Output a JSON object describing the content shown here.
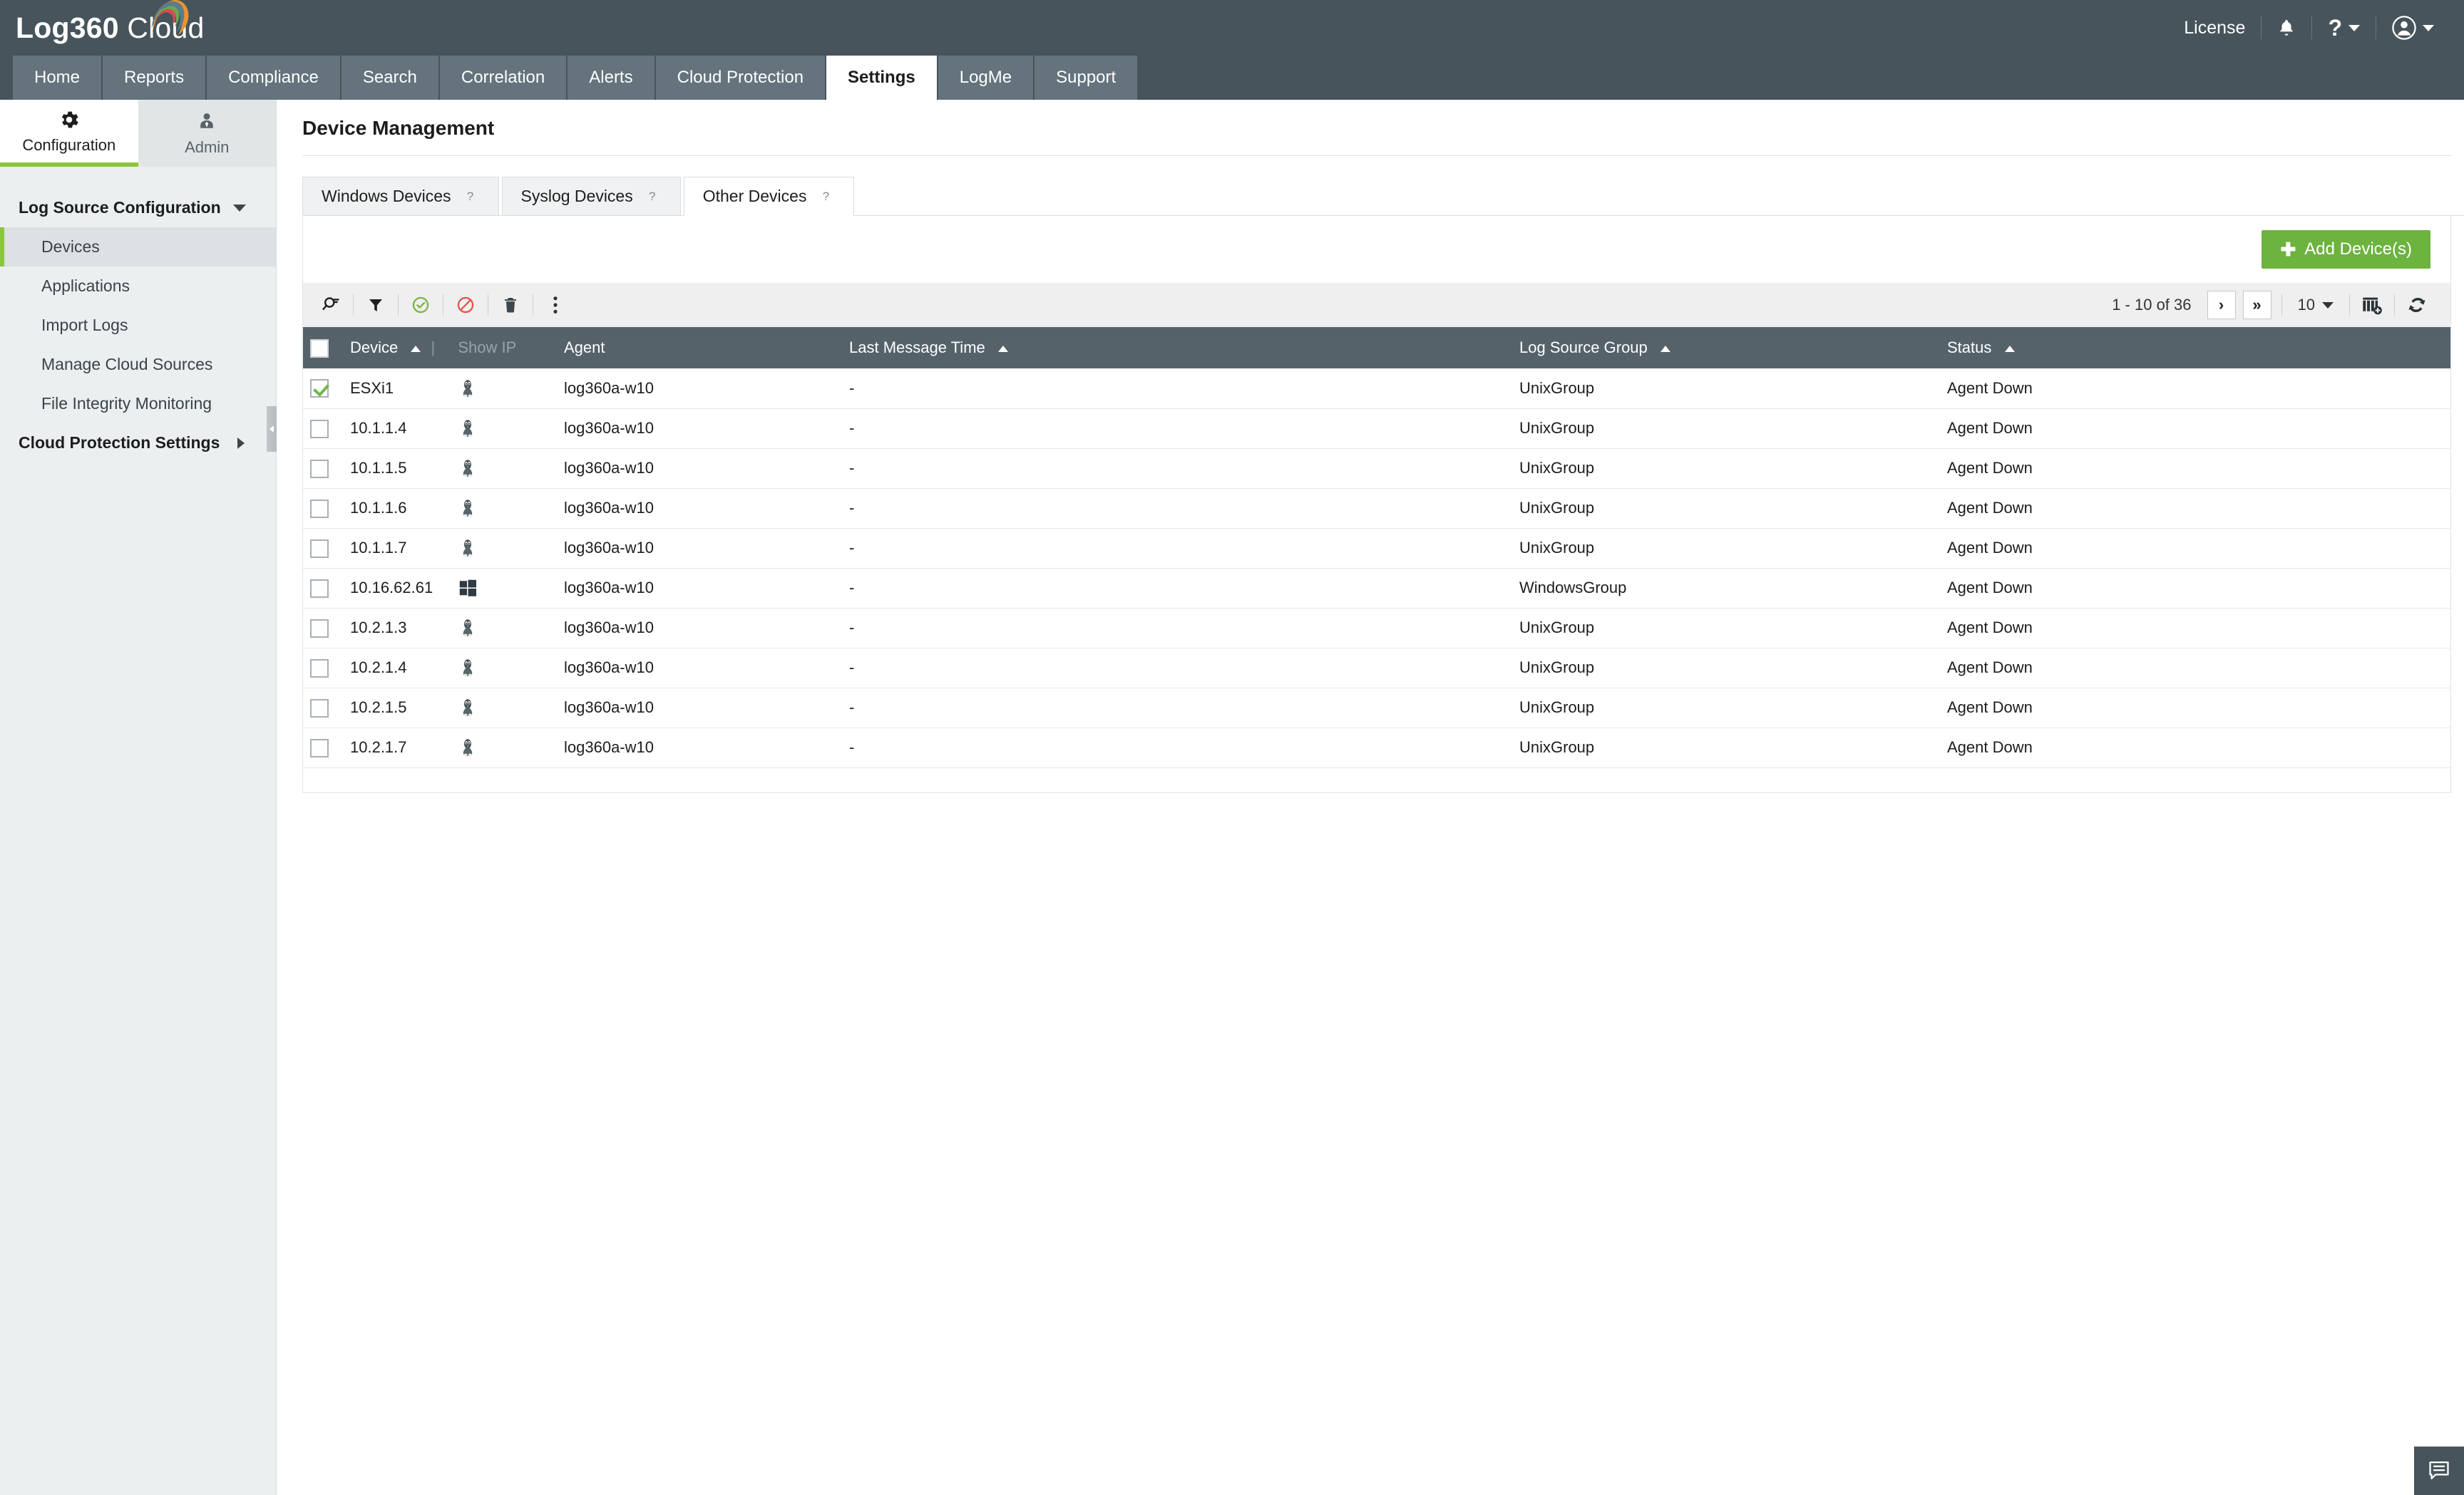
{
  "topbar": {
    "brand_primary": "Log360",
    "brand_secondary": "Cloud",
    "license_label": "License",
    "bell_icon": "bell-icon",
    "help_icon": "question-mark-icon",
    "user_icon": "user-avatar-icon"
  },
  "mainnav": {
    "tabs": [
      {
        "label": "Home",
        "active": false
      },
      {
        "label": "Reports",
        "active": false
      },
      {
        "label": "Compliance",
        "active": false
      },
      {
        "label": "Search",
        "active": false
      },
      {
        "label": "Correlation",
        "active": false
      },
      {
        "label": "Alerts",
        "active": false
      },
      {
        "label": "Cloud Protection",
        "active": false
      },
      {
        "label": "Settings",
        "active": true
      },
      {
        "label": "LogMe",
        "active": false
      },
      {
        "label": "Support",
        "active": false
      }
    ]
  },
  "sidebar": {
    "tabs": [
      {
        "label": "Configuration",
        "icon": "gear-icon",
        "active": true
      },
      {
        "label": "Admin",
        "icon": "user-tie-icon",
        "active": false
      }
    ],
    "sections": [
      {
        "label": "Log Source Configuration",
        "expanded": true,
        "items": [
          {
            "label": "Devices",
            "active": true
          },
          {
            "label": "Applications",
            "active": false
          },
          {
            "label": "Import Logs",
            "active": false
          },
          {
            "label": "Manage Cloud Sources",
            "active": false
          },
          {
            "label": "File Integrity Monitoring",
            "active": false
          }
        ]
      },
      {
        "label": "Cloud Protection Settings",
        "expanded": false,
        "items": []
      }
    ]
  },
  "main": {
    "page_title": "Device Management",
    "tabs": [
      {
        "label": "Windows Devices",
        "help": "?",
        "active": false
      },
      {
        "label": "Syslog Devices",
        "help": "?",
        "active": false
      },
      {
        "label": "Other Devices",
        "help": "?",
        "active": true
      }
    ],
    "add_button": {
      "plus": "✚",
      "label": "Add Device(s)"
    },
    "toolbar": {
      "icons": [
        {
          "name": "search-icon"
        },
        {
          "name": "filter-icon"
        },
        {
          "name": "enable-check-icon"
        },
        {
          "name": "disable-block-icon"
        },
        {
          "name": "delete-trash-icon"
        },
        {
          "name": "more-options-icon"
        }
      ],
      "pagination_label": "1 - 10 of 36",
      "next_page_glyph": "›",
      "last_page_glyph": "»",
      "page_size": "10",
      "column-chooser_icon": "column-settings-icon",
      "refresh_icon": "refresh-icon"
    },
    "table": {
      "columns": [
        {
          "key": "device",
          "label": "Device",
          "sorted": true
        },
        {
          "key": "showip",
          "label": "Show IP",
          "sorted": false
        },
        {
          "key": "icon",
          "label": "",
          "sorted": false
        },
        {
          "key": "agent",
          "label": "Agent",
          "sorted": false
        },
        {
          "key": "last_message_time",
          "label": "Last Message Time",
          "sorted": true
        },
        {
          "key": "log_source_group",
          "label": "Log Source Group",
          "sorted": true
        },
        {
          "key": "status",
          "label": "Status",
          "sorted": true
        }
      ],
      "rows": [
        {
          "selected": true,
          "device": "ESXi1",
          "os": "linux",
          "agent": "log360a-w10",
          "last_message_time": "-",
          "log_source_group": "UnixGroup",
          "status": "Agent Down"
        },
        {
          "selected": false,
          "device": "10.1.1.4",
          "os": "linux",
          "agent": "log360a-w10",
          "last_message_time": "-",
          "log_source_group": "UnixGroup",
          "status": "Agent Down"
        },
        {
          "selected": false,
          "device": "10.1.1.5",
          "os": "linux",
          "agent": "log360a-w10",
          "last_message_time": "-",
          "log_source_group": "UnixGroup",
          "status": "Agent Down"
        },
        {
          "selected": false,
          "device": "10.1.1.6",
          "os": "linux",
          "agent": "log360a-w10",
          "last_message_time": "-",
          "log_source_group": "UnixGroup",
          "status": "Agent Down"
        },
        {
          "selected": false,
          "device": "10.1.1.7",
          "os": "linux",
          "agent": "log360a-w10",
          "last_message_time": "-",
          "log_source_group": "UnixGroup",
          "status": "Agent Down"
        },
        {
          "selected": false,
          "device": "10.16.62.61",
          "os": "windows",
          "agent": "log360a-w10",
          "last_message_time": "-",
          "log_source_group": "WindowsGroup",
          "status": "Agent Down"
        },
        {
          "selected": false,
          "device": "10.2.1.3",
          "os": "linux",
          "agent": "log360a-w10",
          "last_message_time": "-",
          "log_source_group": "UnixGroup",
          "status": "Agent Down"
        },
        {
          "selected": false,
          "device": "10.2.1.4",
          "os": "linux",
          "agent": "log360a-w10",
          "last_message_time": "-",
          "log_source_group": "UnixGroup",
          "status": "Agent Down"
        },
        {
          "selected": false,
          "device": "10.2.1.5",
          "os": "linux",
          "agent": "log360a-w10",
          "last_message_time": "-",
          "log_source_group": "UnixGroup",
          "status": "Agent Down"
        },
        {
          "selected": false,
          "device": "10.2.1.7",
          "os": "linux",
          "agent": "log360a-w10",
          "last_message_time": "-",
          "log_source_group": "UnixGroup",
          "status": "Agent Down"
        }
      ]
    }
  },
  "chat": {
    "icon": "chat-bubble-icon"
  },
  "colors": {
    "header_bg": "#47545c",
    "nav_inactive": "#64737c",
    "accent_green": "#8cc63e",
    "button_green": "#6db33f",
    "table_header": "#55626a",
    "status_red": "#ed5a48",
    "sidebar_bg": "#ebeff0"
  }
}
